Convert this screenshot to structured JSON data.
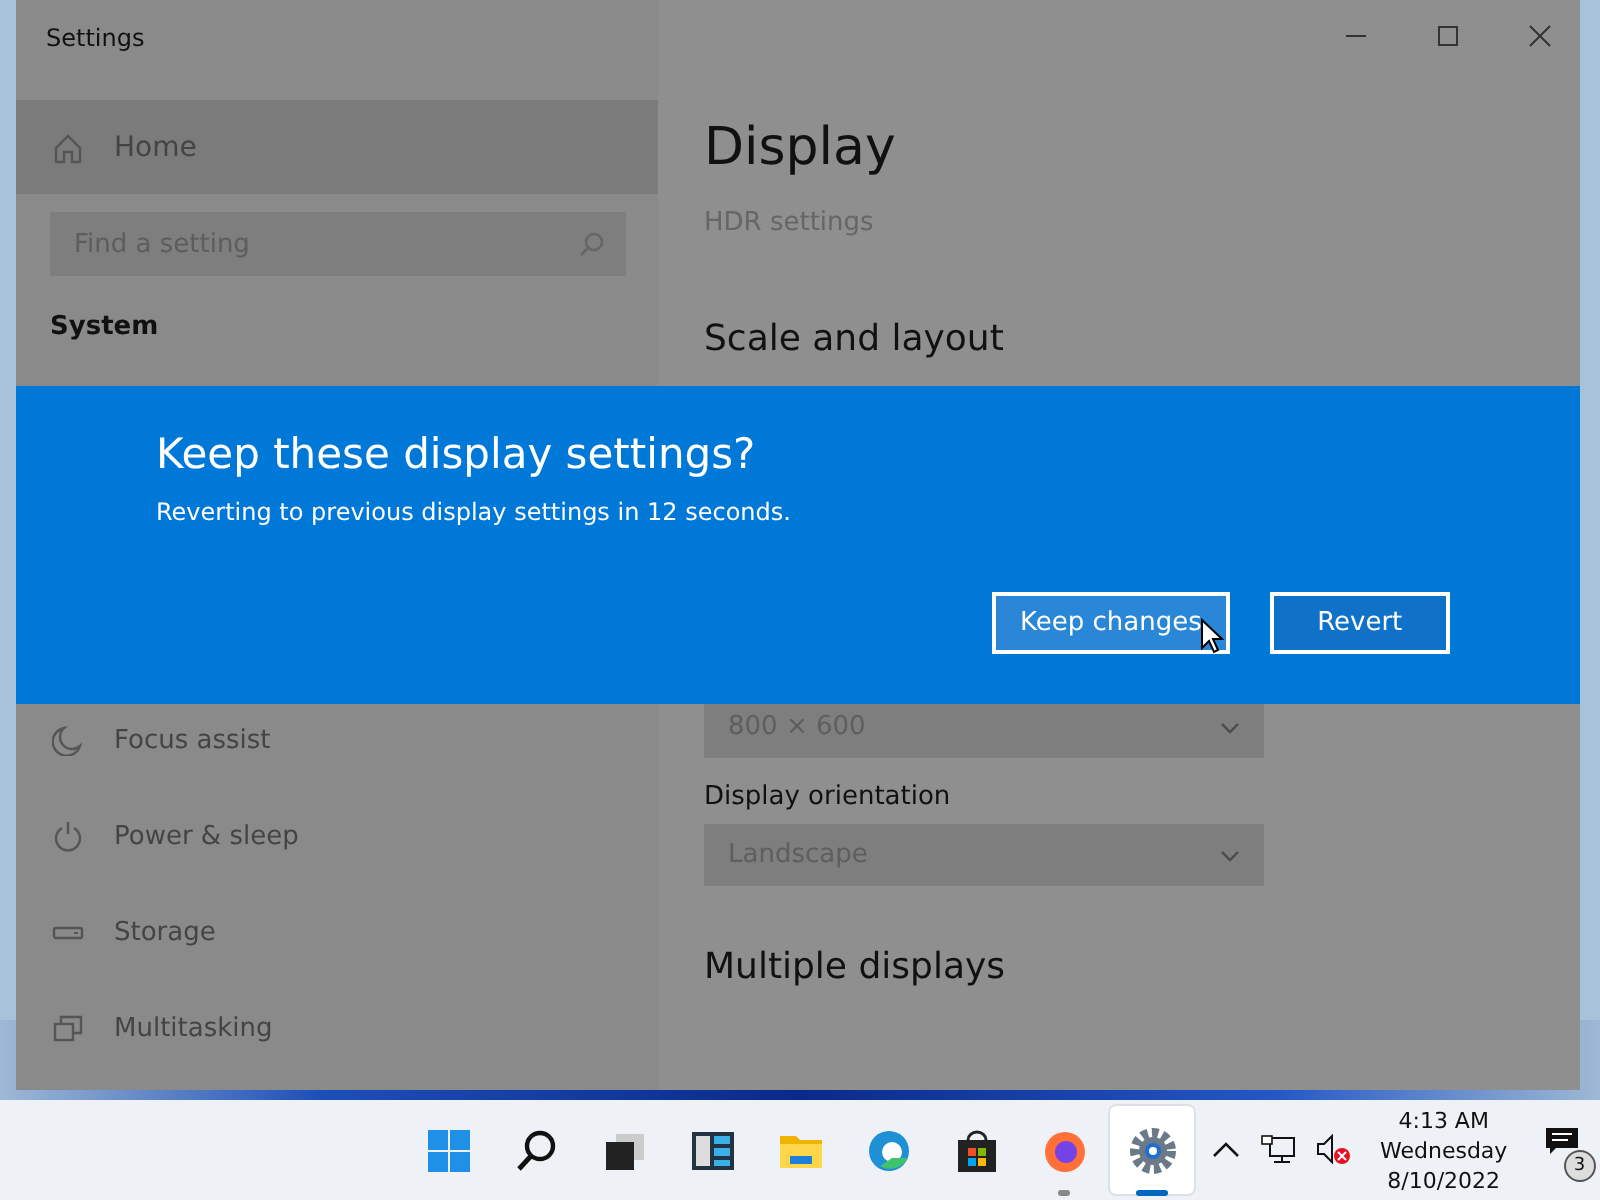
{
  "window": {
    "title": "Settings"
  },
  "sidebar": {
    "home": {
      "label": "Home",
      "selected": true
    },
    "search": {
      "placeholder": "Find a setting"
    },
    "section": "System",
    "items": [
      {
        "kind": "moon",
        "label": "Focus assist"
      },
      {
        "kind": "power",
        "label": "Power & sleep"
      },
      {
        "kind": "storage",
        "label": "Storage"
      },
      {
        "kind": "multitask",
        "label": "Multitasking"
      }
    ]
  },
  "content": {
    "title": "Display",
    "link": "HDR settings",
    "section": "Scale and layout",
    "resolution": {
      "value": "800 × 600"
    },
    "orientation": {
      "label": "Display orientation",
      "value": "Landscape"
    },
    "section_2": "Multiple displays"
  },
  "dialog": {
    "title": "Keep these display settings?",
    "message": "Reverting to previous display settings in 12 seconds.",
    "buttons": [
      {
        "label": "Keep changes",
        "hovered": true
      },
      {
        "label": "Revert",
        "hovered": false
      }
    ]
  },
  "taskbar": {
    "apps": [
      {
        "kind": "start",
        "running": false,
        "selected": false
      },
      {
        "kind": "search",
        "running": false,
        "selected": false
      },
      {
        "kind": "taskview",
        "running": false,
        "selected": false
      },
      {
        "kind": "widgets",
        "running": false,
        "selected": false
      },
      {
        "kind": "explorer",
        "running": false,
        "selected": false
      },
      {
        "kind": "edge",
        "running": false,
        "selected": false
      },
      {
        "kind": "store",
        "running": false,
        "selected": false
      },
      {
        "kind": "firefox",
        "running": true,
        "selected": false
      },
      {
        "kind": "settings",
        "running": true,
        "selected": true
      }
    ],
    "time": "4:13 AM",
    "day": "Wednesday",
    "date": "8/10/2022",
    "notifications": "3"
  }
}
